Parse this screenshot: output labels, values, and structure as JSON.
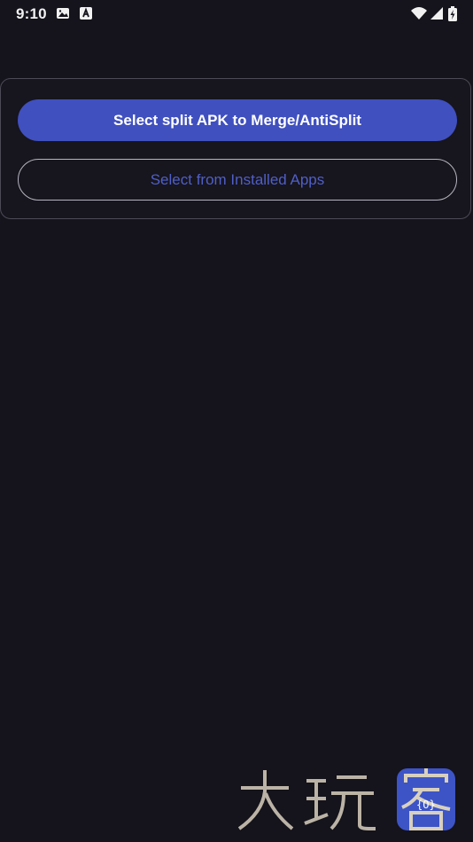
{
  "status_bar": {
    "time": "9:10",
    "icons": [
      "image-icon",
      "accessibility-a-icon",
      "wifi-icon",
      "signal-icon",
      "battery-charging-icon"
    ]
  },
  "card": {
    "primary_button_label": "Select split APK to Merge/AntiSplit",
    "secondary_button_label": "Select from Installed Apps"
  },
  "colors": {
    "background": "#15131b",
    "primary": "#4050bf",
    "secondary_text": "#4f5fc8",
    "card_border": "#4c4a55",
    "outline_border": "#b6b4bf"
  },
  "watermark": {
    "text": "大玩客"
  }
}
